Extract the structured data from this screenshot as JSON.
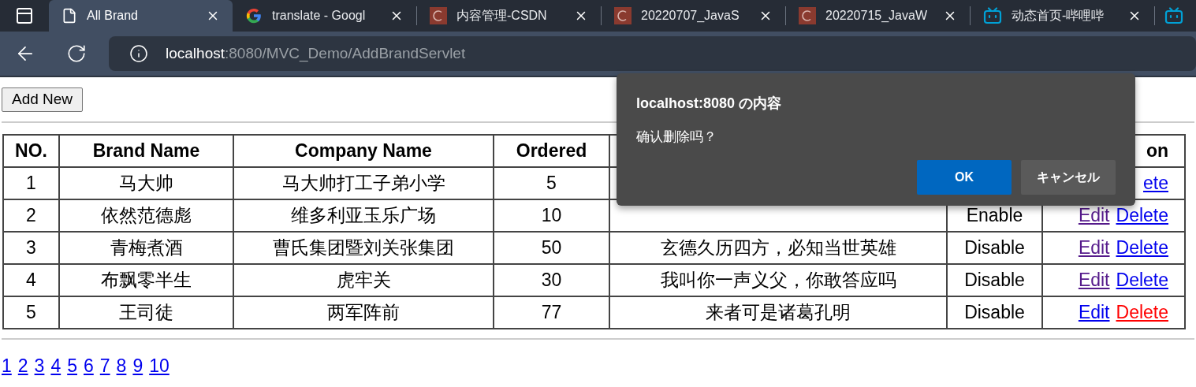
{
  "tabs": [
    {
      "title": "All Brand",
      "kind": "page",
      "selected": true
    },
    {
      "title": "translate - Googl",
      "kind": "google",
      "selected": false
    },
    {
      "title": "内容管理-CSDN",
      "kind": "csdn",
      "selected": false
    },
    {
      "title": "20220707_JavaS",
      "kind": "csdn",
      "selected": false
    },
    {
      "title": "20220715_JavaW",
      "kind": "csdn",
      "selected": false
    },
    {
      "title": "动态首页-哔哩哔",
      "kind": "bilibili",
      "selected": false
    },
    {
      "kind": "bilibili",
      "selected": false
    }
  ],
  "address": {
    "host": "localhost",
    "path": ":8080/MVC_Demo/AddBrandServlet"
  },
  "add_button": "Add New",
  "table": {
    "columns": [
      "NO.",
      "Brand Name",
      "Company Name",
      "Ordered",
      null,
      null,
      "on"
    ],
    "rows": [
      {
        "no": "1",
        "brand": "马大帅",
        "company": "马大帅打工子弟小学",
        "ordered": "5",
        "actions": [
          {
            "label": "ete",
            "visited": false,
            "active": false
          }
        ]
      },
      {
        "no": "2",
        "brand": "依然范德彪",
        "company": "维多利亚玉乐广场",
        "ordered": "10",
        "status": "Enable",
        "actions": [
          {
            "label": "Edit",
            "visited": true,
            "active": false
          },
          {
            "label": "Delete",
            "visited": false,
            "active": false
          }
        ]
      },
      {
        "no": "3",
        "brand": "青梅煮酒",
        "company": "曹氏集团暨刘关张集团",
        "ordered": "50",
        "description": "玄德久历四方，必知当世英雄",
        "status": "Disable",
        "actions": [
          {
            "label": "Edit",
            "visited": true,
            "active": false
          },
          {
            "label": "Delete",
            "visited": false,
            "active": false
          }
        ]
      },
      {
        "no": "4",
        "brand": "布飘零半生",
        "company": "虎牢关",
        "ordered": "30",
        "description": "我叫你一声义父，你敢答应吗",
        "status": "Disable",
        "actions": [
          {
            "label": "Edit",
            "visited": true,
            "active": false
          },
          {
            "label": "Delete",
            "visited": false,
            "active": false
          }
        ]
      },
      {
        "no": "5",
        "brand": "王司徒",
        "company": "两军阵前",
        "ordered": "77",
        "description": "来者可是诸葛孔明",
        "status": "Disable",
        "actions": [
          {
            "label": "Edit",
            "visited": false,
            "active": false
          },
          {
            "label": "Delete",
            "visited": false,
            "active": true
          }
        ]
      }
    ]
  },
  "pages": [
    "1",
    "2",
    "3",
    "4",
    "5",
    "6",
    "7",
    "8",
    "9",
    "10"
  ],
  "dialog": {
    "title": "localhost:8080 の内容",
    "message": "确认删除吗？",
    "buttons": [
      {
        "label": "OK",
        "primary": true
      },
      {
        "label": "キャンセル",
        "primary": false
      }
    ]
  }
}
